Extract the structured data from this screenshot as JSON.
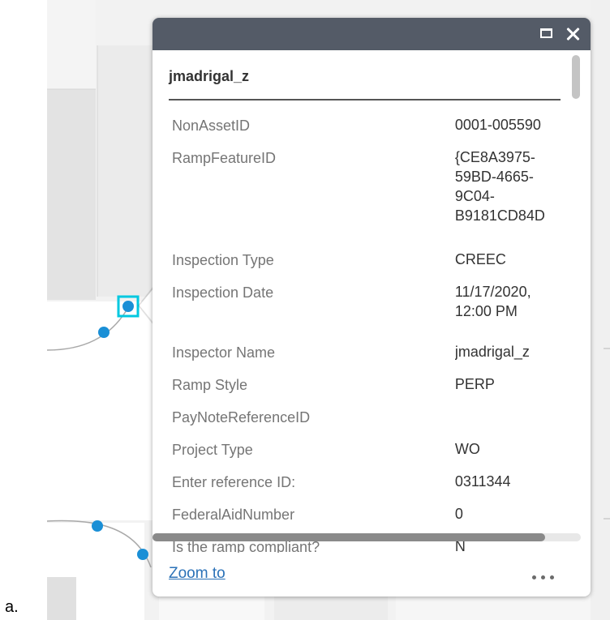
{
  "doc_label": "a.",
  "popup": {
    "title": "jmadrigal_z",
    "fields": [
      {
        "label": "NonAssetID",
        "value": "0001-005590"
      },
      {
        "label": "RampFeatureID",
        "value": "{CE8A3975-\n59BD-4665-\n9C04-\nB9181CD84D"
      },
      {
        "label": "Inspection Type",
        "value": "CREEC"
      },
      {
        "label": "Inspection Date",
        "value": "11/17/2020,\n12:00 PM"
      },
      {
        "label": "Inspector Name",
        "value": "jmadrigal_z"
      },
      {
        "label": "Ramp Style",
        "value": "PERP"
      },
      {
        "label": "PayNoteReferenceID",
        "value": ""
      },
      {
        "label": "Project Type",
        "value": "WO"
      },
      {
        "label": "Enter reference ID:",
        "value": "0311344"
      },
      {
        "label": "FederalAidNumber",
        "value": "0"
      },
      {
        "label": "Is the ramp compliant?",
        "value": "N"
      }
    ],
    "footer": {
      "zoom_label": "Zoom to"
    }
  },
  "colors": {
    "header": "#545b67",
    "link": "#2b72b8",
    "marker": "#1a8fd6",
    "selection": "#00c8e0"
  },
  "icons": [
    "maximize-icon",
    "close-icon",
    "more-icon"
  ]
}
